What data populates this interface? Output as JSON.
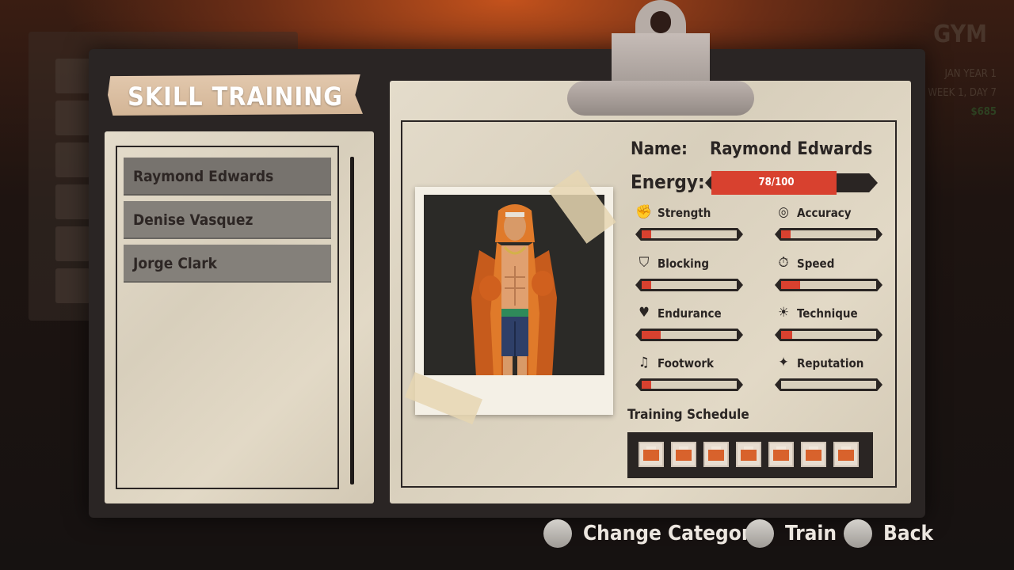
{
  "background": {
    "gym_title": "GYM",
    "date_year": "JAN YEAR 1",
    "week_day": "WEEK 1, DAY 7",
    "money": "$685"
  },
  "title": "SKILL TRAINING",
  "fighters": [
    {
      "name": "Raymond Edwards"
    },
    {
      "name": "Denise Vasquez"
    },
    {
      "name": "Jorge Clark"
    }
  ],
  "profile": {
    "name_label": "Name:",
    "name_value": "Raymond Edwards",
    "energy_label": "Energy:",
    "energy_text": "78/100",
    "energy_fraction": 0.78
  },
  "stats": [
    {
      "label": "Strength",
      "icon": "fist-icon",
      "level": 0.1
    },
    {
      "label": "Accuracy",
      "icon": "target-icon",
      "level": 0.1
    },
    {
      "label": "Blocking",
      "icon": "shield-icon",
      "level": 0.1
    },
    {
      "label": "Speed",
      "icon": "stopwatch-icon",
      "level": 0.2
    },
    {
      "label": "Endurance",
      "icon": "heart-pulse-icon",
      "level": 0.2
    },
    {
      "label": "Technique",
      "icon": "lightbulb-icon",
      "level": 0.12
    },
    {
      "label": "Footwork",
      "icon": "footprints-icon",
      "level": 0.1
    },
    {
      "label": "Reputation",
      "icon": "star-icon",
      "level": 0.0
    }
  ],
  "schedule": {
    "title": "Training Schedule",
    "slots": [
      "bed-icon",
      "bed-icon",
      "bed-icon",
      "bed-icon",
      "bed-icon",
      "bed-icon",
      "bed-icon"
    ]
  },
  "footer": {
    "change_category": "Change Category",
    "train": "Train",
    "back": "Back"
  },
  "colors": {
    "accent_red": "#d8412f",
    "paper": "#d8cfbc",
    "ink": "#2a2523"
  }
}
